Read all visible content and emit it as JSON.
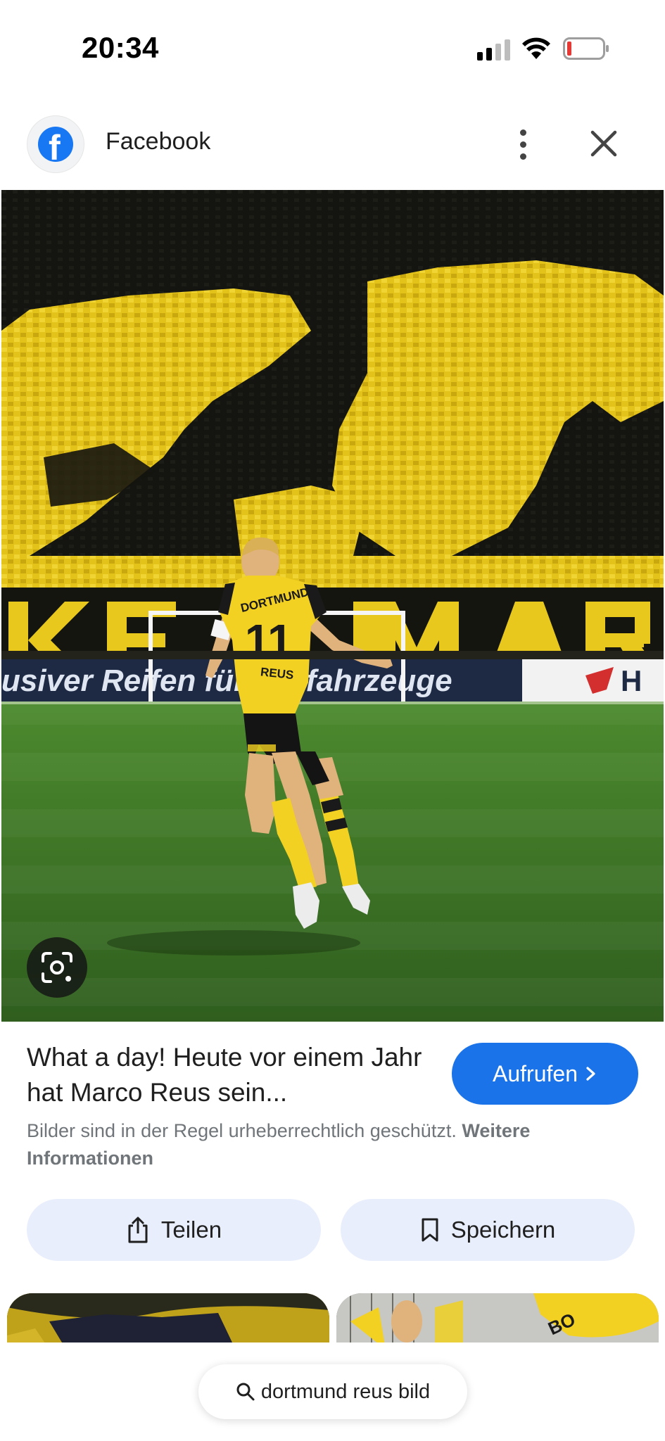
{
  "status_bar": {
    "time": "20:34"
  },
  "header": {
    "source_name": "Facebook",
    "source_logo_letter": "f",
    "icons": [
      "facebook-logo-icon",
      "more-vert-icon",
      "close-icon"
    ]
  },
  "image": {
    "background_text_1": "usiver Reifen für Profahrzeuge",
    "banner_letters": "NKE MAR",
    "jersey_brand": "DORTMUND",
    "jersey_number": "11",
    "jersey_name": "REUS",
    "lens_icon": "lens-icon"
  },
  "result": {
    "title": "What a day! Heute vor einem Jahr hat Marco Reus sein...",
    "visit_label": "Aufrufen",
    "copyright_text": "Bilder sind in der Regel urheberrechtlich geschützt.",
    "copyright_link": "Weitere Informationen"
  },
  "actions": {
    "share_label": "Teilen",
    "save_label": "Speichern"
  },
  "search": {
    "query": "dortmund reus bild"
  },
  "colors": {
    "accent": "#1a73e8",
    "chip_bg": "#e8eefc",
    "bvb_yellow": "#f3d122",
    "facebook_blue": "#1877f2"
  }
}
